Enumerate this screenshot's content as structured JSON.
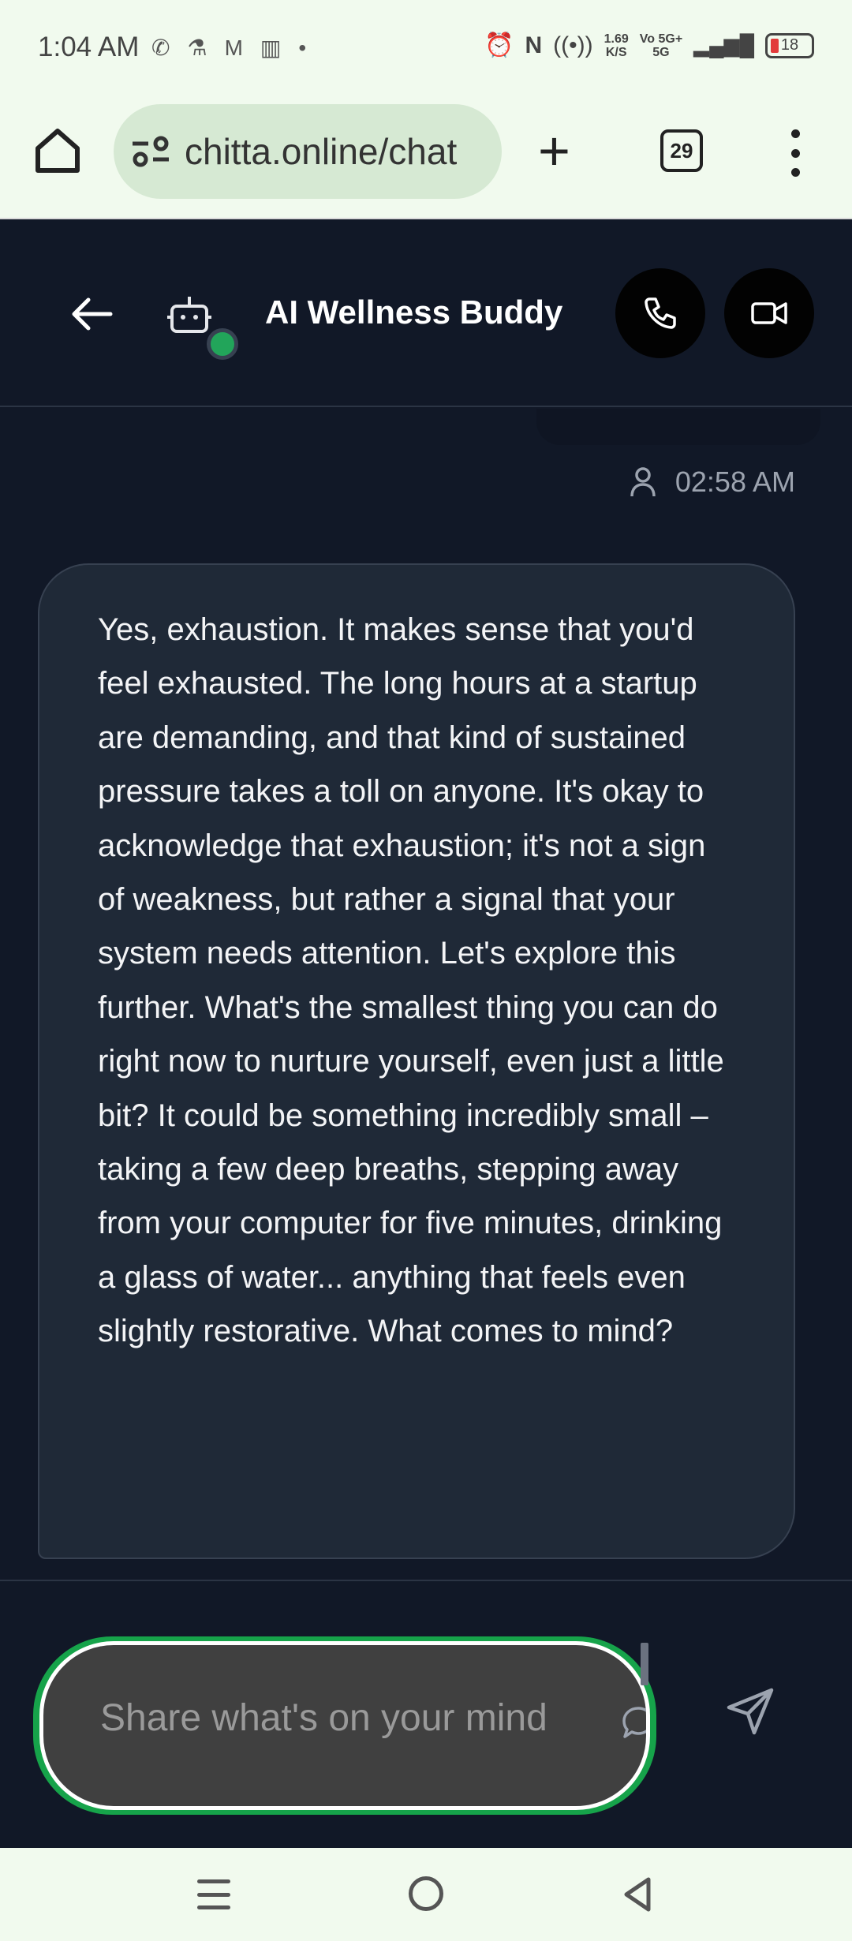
{
  "status_bar": {
    "time": "1:04 AM",
    "net_speed_value": "1.69",
    "net_speed_unit": "K/S",
    "network_label_top": "Vo 5G+",
    "network_label_bottom": "5G",
    "battery_level": "18"
  },
  "browser": {
    "url": "chitta.online/chat",
    "tab_count": "29"
  },
  "chat_header": {
    "title": "AI Wellness Buddy"
  },
  "chat": {
    "timestamp": "02:58 AM",
    "assistant_message": "Yes, exhaustion. It makes sense that you'd feel exhausted. The long hours at a startup are demanding, and that kind of sustained pressure takes a toll on anyone. It's okay to acknowledge that exhaustion; it's not a sign of weakness, but rather a signal that your system needs attention. Let's explore this further. What's the smallest thing you can do right now to nurture yourself, even just a little bit? It could be something incredibly small – taking a few deep breaths, stepping away from your computer for five minutes, drinking a glass of water... anything that feels even slightly restorative. What comes to mind?"
  },
  "composer": {
    "placeholder": "Share what's on your mind"
  },
  "colors": {
    "accent": "#22a55a",
    "background": "#111827",
    "bubble": "#1f2937"
  }
}
